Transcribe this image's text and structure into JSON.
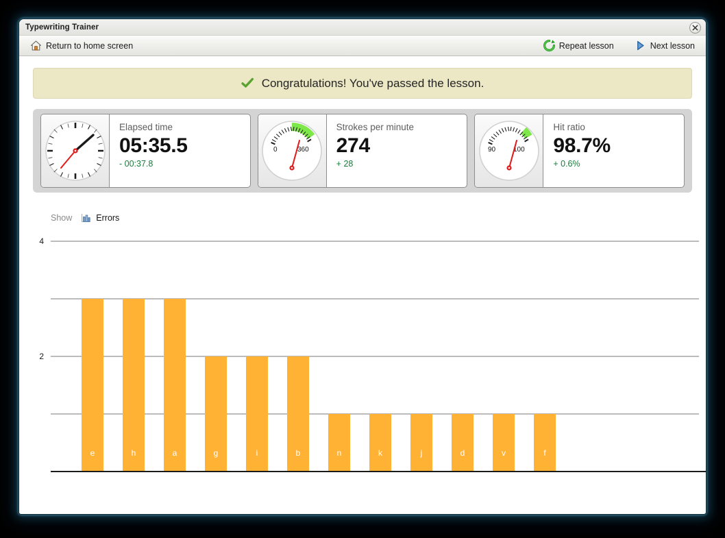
{
  "window": {
    "title": "Typewriting Trainer",
    "close_label": "×"
  },
  "toolbar": {
    "home_label": "Return to home screen",
    "home_icon": "home-icon",
    "repeat_label": "Repeat lesson",
    "repeat_icon": "refresh-icon",
    "next_label": "Next lesson",
    "next_icon": "play-triangle-icon"
  },
  "banner": {
    "icon": "green-check-icon",
    "text": "Congratulations! You've passed the lesson.",
    "background": "#ece8c6"
  },
  "stats": [
    {
      "gauge": "stopwatch-gauge",
      "label": "Elapsed time",
      "value": "05:35.5",
      "delta": "- 00:37.8",
      "delta_color": "#167d3a",
      "gauge_min": "",
      "gauge_max": ""
    },
    {
      "gauge": "speed-gauge",
      "label": "Strokes per minute",
      "value": "274",
      "delta": "+ 28",
      "delta_color": "#167d3a",
      "gauge_min": "0",
      "gauge_max": "360"
    },
    {
      "gauge": "ratio-gauge",
      "label": "Hit ratio",
      "value": "98.7%",
      "delta": "+ 0.6%",
      "delta_color": "#167d3a",
      "gauge_min": "90",
      "gauge_max": "100"
    }
  ],
  "show_row": {
    "show_label": "Show",
    "errors_label": "Errors",
    "errors_icon": "bar-chart-icon"
  },
  "chart_data": {
    "type": "bar",
    "title": "",
    "xlabel": "",
    "ylabel": "",
    "categories": [
      "e",
      "h",
      "a",
      "g",
      "i",
      "b",
      "n",
      "k",
      "j",
      "d",
      "v",
      "f"
    ],
    "values": [
      3,
      3,
      3,
      2,
      2,
      2,
      1,
      1,
      1,
      1,
      1,
      1
    ],
    "series": [
      {
        "name": "Errors",
        "values": [
          3,
          3,
          3,
          2,
          2,
          2,
          1,
          1,
          1,
          1,
          1,
          1
        ]
      }
    ],
    "ylim": [
      0,
      4
    ],
    "yticks": [
      0,
      1,
      2,
      3,
      4
    ],
    "ytick_labels": [
      "",
      "",
      "2",
      "",
      "4"
    ],
    "grid": true,
    "legend": "none",
    "bar_color": "#ffb233",
    "bar_label_color": "#ffffff",
    "axis_color": "#1a1a1a",
    "gridline_color": "#7a7a7a"
  }
}
